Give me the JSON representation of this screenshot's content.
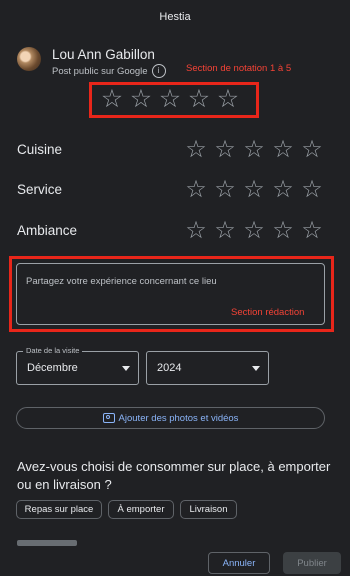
{
  "app": {
    "title": "Hestia"
  },
  "user": {
    "name": "Lou Ann Gabillon",
    "subtitle": "Post public sur Google",
    "info_icon": "info-icon"
  },
  "annotations": {
    "rating": "Section de notation 1 à 5",
    "writing": "Section rédaction"
  },
  "overall_rating": {
    "stars": 5,
    "value": 0
  },
  "categories": [
    {
      "label": "Cuisine",
      "stars": 5
    },
    {
      "label": "Service",
      "stars": 5
    },
    {
      "label": "Ambiance",
      "stars": 5
    }
  ],
  "review": {
    "placeholder": "Partagez votre expérience concernant ce lieu"
  },
  "visit": {
    "label": "Date de la visite",
    "month": "Décembre",
    "year": "2024"
  },
  "add_media": {
    "label": "Ajouter des photos et vidéos",
    "icon": "add-photo-icon"
  },
  "question": {
    "text": "Avez-vous choisi de consommer sur place, à emporter ou en livraison ?",
    "options": [
      "Repas sur place",
      "À emporter",
      "Livraison"
    ]
  },
  "footer": {
    "cancel": "Annuler",
    "publish": "Publier"
  },
  "colors": {
    "background": "#202124",
    "annotation_red": "#e8261a",
    "accent_blue": "#8ab4f8"
  }
}
